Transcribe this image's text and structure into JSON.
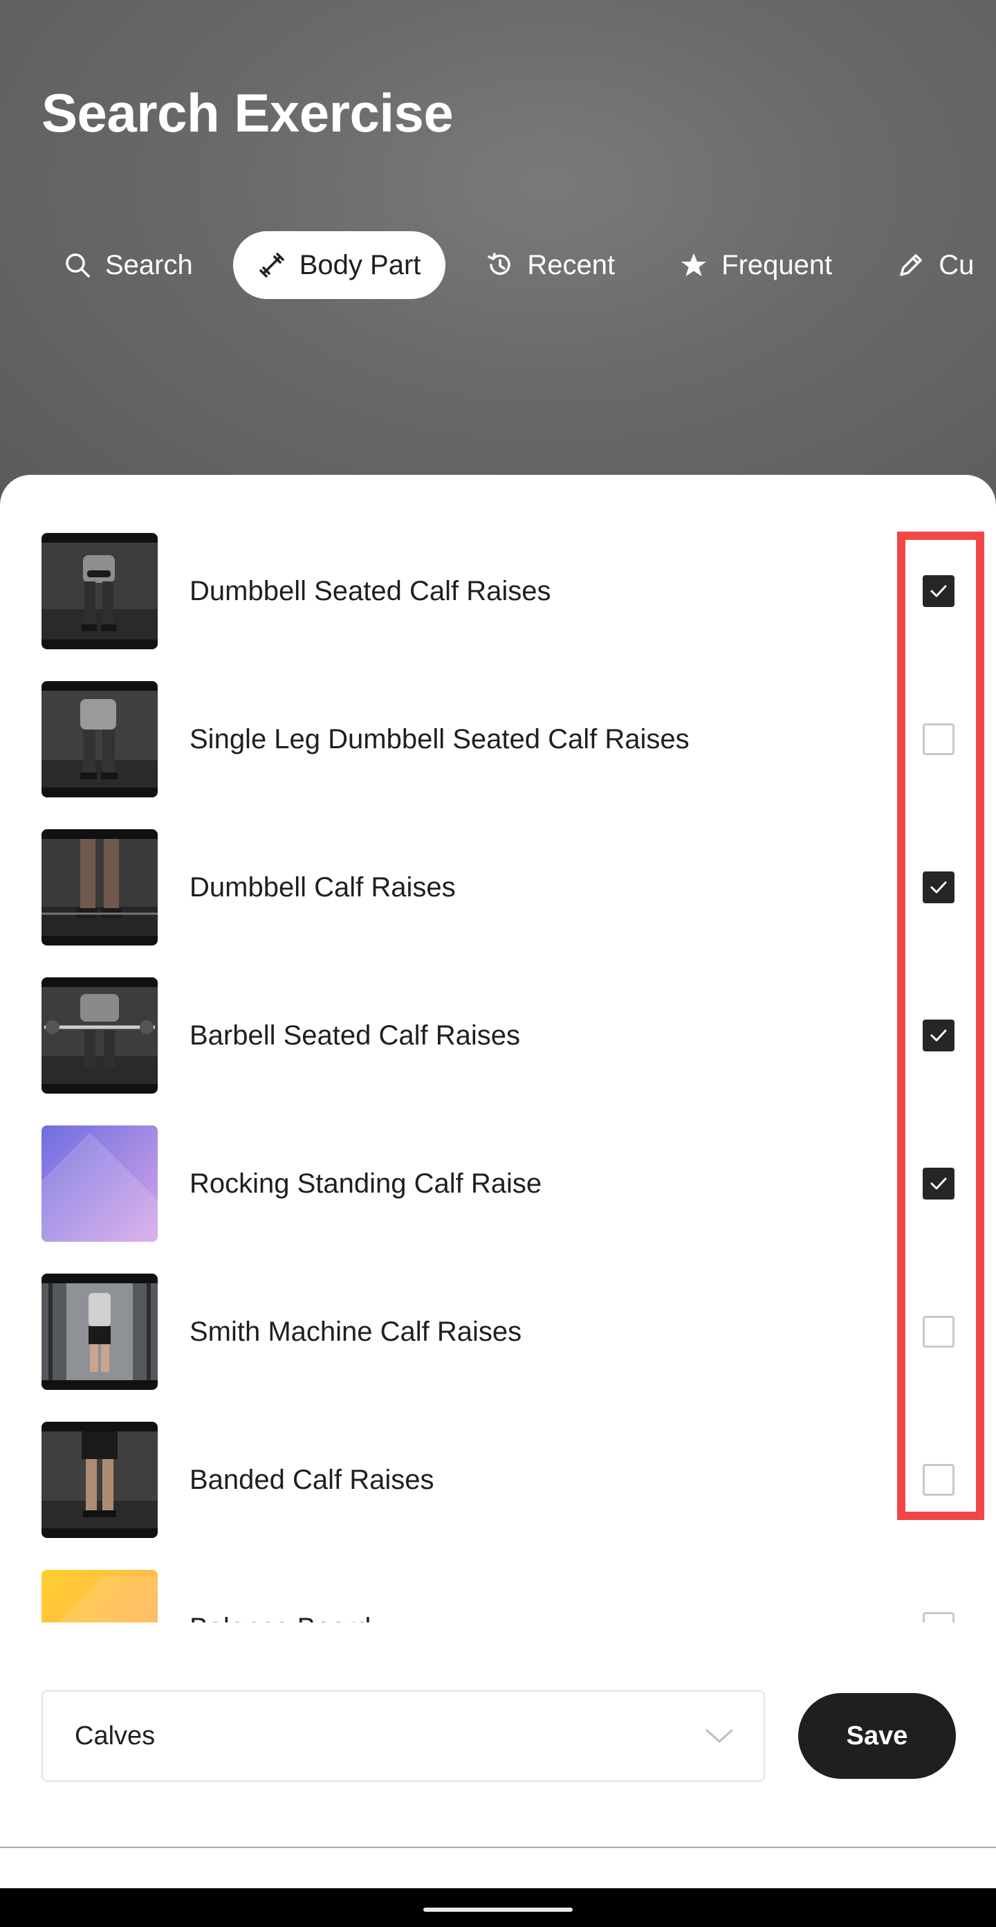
{
  "header": {
    "title": "Search Exercise"
  },
  "tabs": [
    {
      "label": "Search",
      "icon": "search-icon",
      "active": false
    },
    {
      "label": "Body Part",
      "icon": "body-part-icon",
      "active": true
    },
    {
      "label": "Recent",
      "icon": "history-icon",
      "active": false
    },
    {
      "label": "Frequent",
      "icon": "star-icon",
      "active": false
    },
    {
      "label": "Cu",
      "icon": "pencil-icon",
      "active": false
    }
  ],
  "exercises": [
    {
      "name": "Dumbbell Seated Calf Raises",
      "checked": true,
      "thumb": "video-frame"
    },
    {
      "name": "Single Leg Dumbbell Seated Calf Raises",
      "checked": false,
      "thumb": "video-frame"
    },
    {
      "name": "Dumbbell Calf Raises",
      "checked": true,
      "thumb": "video-frame"
    },
    {
      "name": "Barbell Seated Calf Raises",
      "checked": true,
      "thumb": "video-frame"
    },
    {
      "name": "Rocking Standing Calf Raise",
      "checked": true,
      "thumb": "purple-placeholder"
    },
    {
      "name": "Smith Machine Calf Raises",
      "checked": false,
      "thumb": "video-frame"
    },
    {
      "name": "Banded Calf Raises",
      "checked": false,
      "thumb": "video-frame"
    },
    {
      "name": "Balance Board",
      "checked": false,
      "thumb": "yellow-placeholder"
    }
  ],
  "footer": {
    "body_part_select": "Calves",
    "save_label": "Save"
  },
  "colors": {
    "highlight": "#f34747",
    "checked": "#262626",
    "primary_button": "#1f1f1f"
  }
}
